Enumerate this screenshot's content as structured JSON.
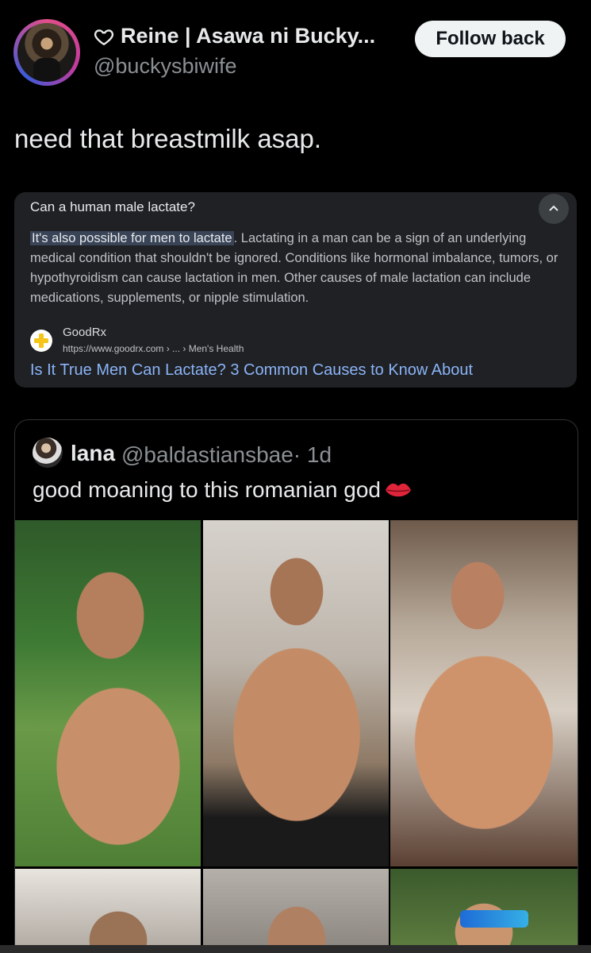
{
  "header": {
    "display_name": "Reine | Asawa ni Bucky...",
    "handle": "@buckysbiwife",
    "follow_button": "Follow back",
    "heart_icon": "heart-outline-icon"
  },
  "tweet": {
    "text": "need that breastmilk asap."
  },
  "google_card": {
    "question": "Can a human male lactate?",
    "answer_highlight": "It's also possible for men to lactate",
    "answer_rest": ". Lactating in a man can be a sign of an underlying medical condition that shouldn't be ignored. Conditions like hormonal imbalance, tumors, or hypothyroidism can cause lactation in men. Other causes of male lactation can include medications, supplements, or nipple stimulation.",
    "source_name": "GoodRx",
    "source_url": "https://www.goodrx.com › ... › Men's Health",
    "result_title": "Is It True Men Can Lactate? 3 Common Causes to Know About",
    "colors": {
      "link": "#8ab4f8",
      "card_bg": "#202124",
      "highlight": "#394457"
    }
  },
  "quote_tweet": {
    "name": "lana",
    "handle": "@baldastiansbae",
    "time": "· 1d",
    "text": "good moaning to this romanian god",
    "emoji_icon": "kiss-lips-icon",
    "photos": [
      "photo-1",
      "photo-2",
      "photo-3",
      "photo-4",
      "photo-5",
      "photo-6"
    ]
  }
}
